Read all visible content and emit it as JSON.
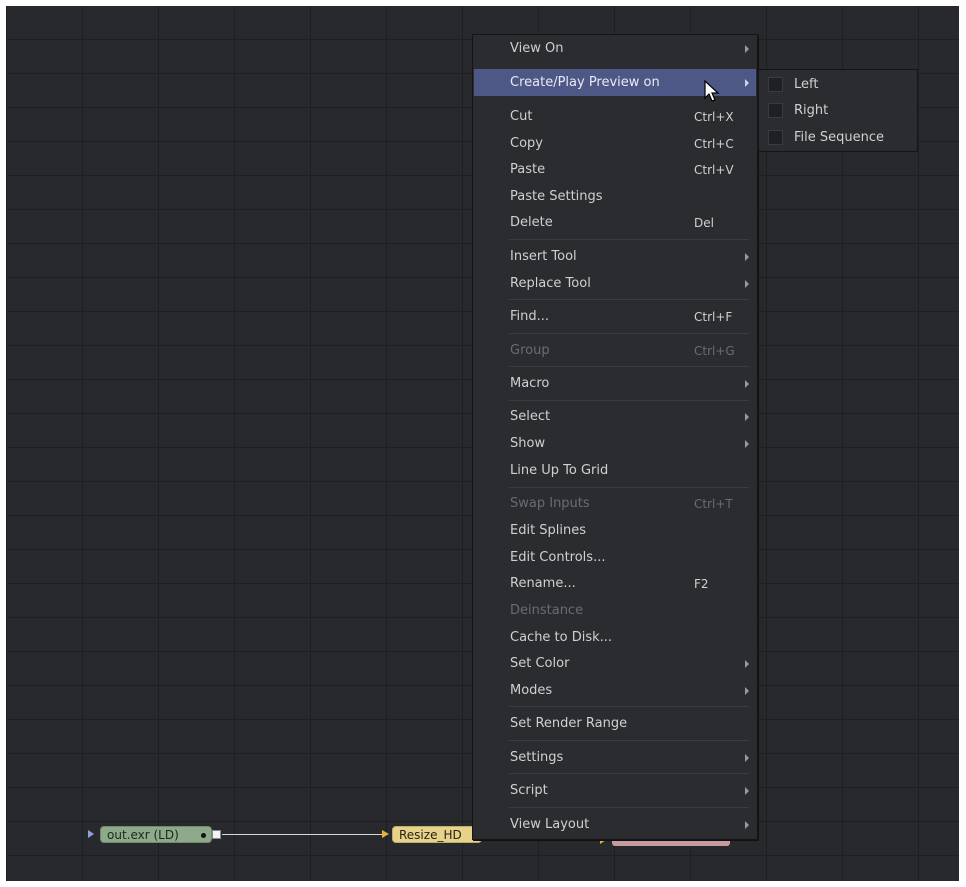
{
  "context_menu": {
    "items": [
      {
        "label": "View On",
        "shortcut": "",
        "submenu": true
      },
      {
        "label": "Create/Play Preview on",
        "shortcut": "",
        "submenu": true,
        "highlighted": true
      },
      {
        "label": "Cut",
        "shortcut": "Ctrl+X"
      },
      {
        "label": "Copy",
        "shortcut": "Ctrl+C"
      },
      {
        "label": "Paste",
        "shortcut": "Ctrl+V"
      },
      {
        "label": "Paste Settings",
        "shortcut": ""
      },
      {
        "label": "Delete",
        "shortcut": "Del"
      },
      {
        "label": "Insert Tool",
        "shortcut": "",
        "submenu": true
      },
      {
        "label": "Replace Tool",
        "shortcut": "",
        "submenu": true
      },
      {
        "label": "Find...",
        "shortcut": "Ctrl+F"
      },
      {
        "label": "Group",
        "shortcut": "Ctrl+G",
        "disabled": true
      },
      {
        "label": "Macro",
        "shortcut": "",
        "submenu": true
      },
      {
        "label": "Select",
        "shortcut": "",
        "submenu": true
      },
      {
        "label": "Show",
        "shortcut": "",
        "submenu": true
      },
      {
        "label": "Line Up To Grid",
        "shortcut": ""
      },
      {
        "label": "Swap Inputs",
        "shortcut": "Ctrl+T",
        "disabled": true
      },
      {
        "label": "Edit Splines",
        "shortcut": ""
      },
      {
        "label": "Edit Controls...",
        "shortcut": ""
      },
      {
        "label": "Rename...",
        "shortcut": "F2"
      },
      {
        "label": "Deinstance",
        "shortcut": "",
        "disabled": true
      },
      {
        "label": "Cache to Disk...",
        "shortcut": ""
      },
      {
        "label": "Set Color",
        "shortcut": "",
        "submenu": true
      },
      {
        "label": "Modes",
        "shortcut": "",
        "submenu": true
      },
      {
        "label": "Set Render Range",
        "shortcut": ""
      },
      {
        "label": "Settings",
        "shortcut": "",
        "submenu": true
      },
      {
        "label": "Script",
        "shortcut": "",
        "submenu": true
      },
      {
        "label": "View Layout",
        "shortcut": "",
        "submenu": true
      }
    ]
  },
  "preview_submenu": {
    "items": [
      {
        "label": "Left"
      },
      {
        "label": "Right"
      },
      {
        "label": "File Sequence"
      }
    ]
  },
  "nodes": {
    "loader_label": "out.exr  (LD)",
    "resize_label": "Resize_HD"
  },
  "colors": {
    "canvas": "#28292d",
    "grid": "#1e1f22",
    "menu_bg": "#2b2c30",
    "highlight": "#4e5887",
    "loader_node": "#8fa98b",
    "resize_node": "#e6d28a",
    "saver_node": "#c79aa0"
  }
}
